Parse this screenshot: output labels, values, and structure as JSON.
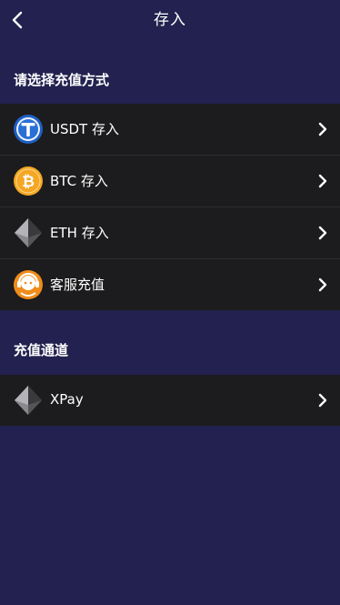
{
  "header": {
    "title": "存入",
    "back_icon": "chevron-left-icon"
  },
  "deposit_methods": {
    "title": "请选择充值方式",
    "items": [
      {
        "label": "USDT 存入",
        "icon": "usdt-icon"
      },
      {
        "label": "BTC 存入",
        "icon": "bitcoin-icon"
      },
      {
        "label": "ETH 存入",
        "icon": "ethereum-icon"
      },
      {
        "label": "客服充值",
        "icon": "customer-service-icon"
      }
    ]
  },
  "channels": {
    "title": "充值通道",
    "items": [
      {
        "label": "XPay",
        "icon": "ethereum-icon"
      }
    ]
  },
  "colors": {
    "background": "#22214f",
    "list_background": "#1c1c1e",
    "text": "#ffffff",
    "usdt_blue": "#2a6fd6",
    "btc_orange": "#f5a623",
    "service_orange": "#f08c1a"
  }
}
